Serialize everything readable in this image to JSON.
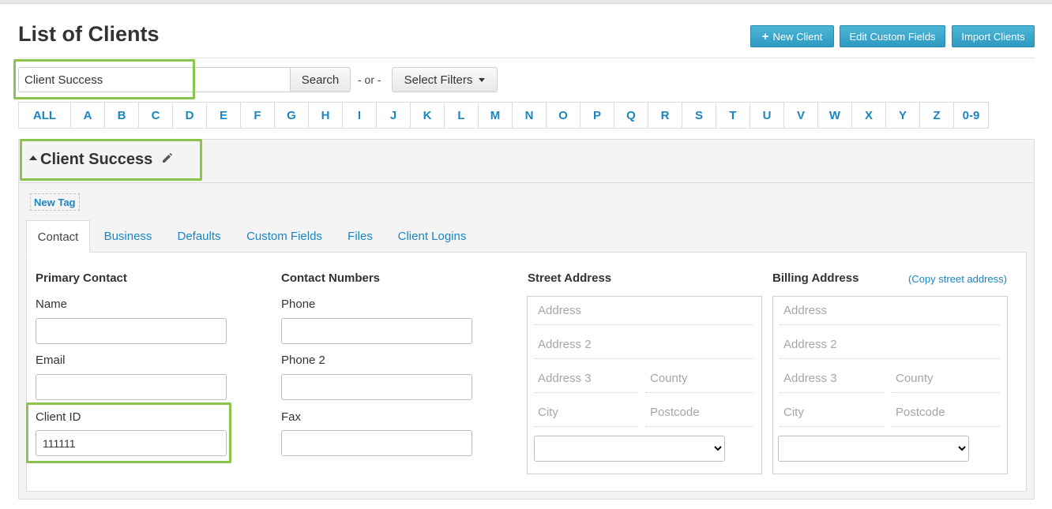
{
  "page": {
    "title": "List of Clients"
  },
  "header_buttons": {
    "new_client": "New Client",
    "edit_custom_fields": "Edit Custom Fields",
    "import_clients": "Import Clients"
  },
  "search": {
    "value": "Client Success",
    "button": "Search",
    "or_text": "- or -",
    "filters_button": "Select Filters"
  },
  "alphabet": [
    "ALL",
    "A",
    "B",
    "C",
    "D",
    "E",
    "F",
    "G",
    "H",
    "I",
    "J",
    "K",
    "L",
    "M",
    "N",
    "O",
    "P",
    "Q",
    "R",
    "S",
    "T",
    "U",
    "V",
    "W",
    "X",
    "Y",
    "Z",
    "0-9"
  ],
  "client": {
    "name": "Client Success",
    "new_tag": "New Tag"
  },
  "tabs": [
    {
      "label": "Contact",
      "active": true
    },
    {
      "label": "Business"
    },
    {
      "label": "Defaults"
    },
    {
      "label": "Custom Fields"
    },
    {
      "label": "Files"
    },
    {
      "label": "Client Logins"
    }
  ],
  "contact": {
    "primary_title": "Primary Contact",
    "name_label": "Name",
    "name_value": "",
    "email_label": "Email",
    "email_value": "",
    "client_id_label": "Client ID",
    "client_id_value": "111111",
    "numbers_title": "Contact Numbers",
    "phone_label": "Phone",
    "phone2_label": "Phone 2",
    "fax_label": "Fax"
  },
  "street": {
    "title": "Street Address",
    "address": "Address",
    "address2": "Address 2",
    "address3": "Address 3",
    "county": "County",
    "city": "City",
    "postcode": "Postcode"
  },
  "billing": {
    "title": "Billing Address",
    "copy_link": "(Copy street address)",
    "address": "Address",
    "address2": "Address 2",
    "address3": "Address 3",
    "county": "County",
    "city": "City",
    "postcode": "Postcode"
  },
  "colors": {
    "accent": "#1a86c0",
    "button": "#2f9ac2",
    "highlight": "#8cc34b"
  }
}
